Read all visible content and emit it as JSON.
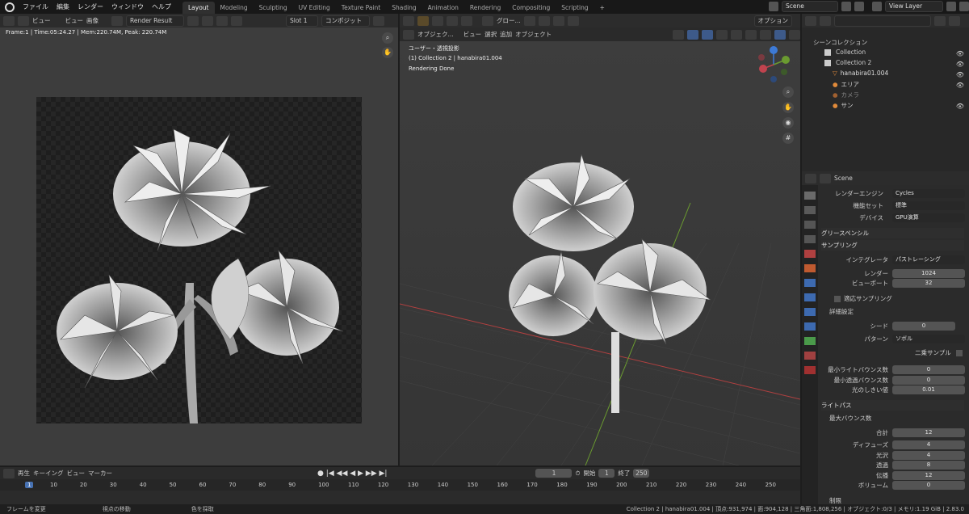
{
  "menu": {
    "file": "ファイル",
    "edit": "編集",
    "render": "レンダー",
    "window": "ウィンドウ",
    "help": "ヘルプ"
  },
  "workspaces": [
    "Layout",
    "Modeling",
    "Sculpting",
    "UV Editing",
    "Texture Paint",
    "Shading",
    "Animation",
    "Rendering",
    "Compositing",
    "Scripting",
    "+"
  ],
  "scene_name": "Scene",
  "view_layer": "View Layer",
  "image_editor": {
    "view_menu": "ビュー",
    "view_btn": "ビュー",
    "image_menu": "画像",
    "image_name": "Render Result",
    "slot": "Slot 1",
    "composite": "コンポジット",
    "info": "Frame:1 | Time:05:24.27 | Mem:220.74M, Peak: 220.74M"
  },
  "viewport": {
    "mode": "オブジェク...",
    "view": "ビュー",
    "select": "選択",
    "add": "追加",
    "object": "オブジェクト",
    "orient": "グロー...",
    "options": "オプション",
    "line1": "ユーザー・透視投影",
    "line2": "(1) Collection 2 | hanabira01.004",
    "line3": "Rendering Done",
    "gizmo_z": "Z",
    "gizmo_y": "Y",
    "gizmo_x": "X"
  },
  "outliner": {
    "title": "シーンコレクション",
    "items": [
      "Collection",
      "Collection 2",
      "hanabira01.004",
      "エリア",
      "カメラ",
      "サン"
    ]
  },
  "props": {
    "scene": "Scene",
    "render_engine_label": "レンダーエンジン",
    "render_engine": "Cycles",
    "feature_set_label": "機能セット",
    "feature_set": "標準",
    "device_label": "デバイス",
    "device": "GPU演算",
    "grease": "グリースペンシル",
    "sampling": "サンプリング",
    "integrator_label": "インテグレータ",
    "integrator": "パストレーシング",
    "render_label": "レンダー",
    "render_val": "1024",
    "viewport_label": "ビューポート",
    "viewport_val": "32",
    "adaptive": "適応サンプリング",
    "advanced": "詳細設定",
    "seed_label": "シード",
    "seed": "0",
    "pattern_label": "パターン",
    "pattern": "ソボル",
    "square": "二乗サンプル",
    "min_light_label": "最小ライトバウンス数",
    "min_light": "0",
    "min_trans_label": "最小透過バウンス数",
    "min_trans": "0",
    "light_thresh_label": "光のしきい値",
    "light_thresh": "0.01",
    "lightpaths": "ライトパス",
    "max_bounce": "最大バウンス数",
    "total_label": "合計",
    "total": "12",
    "diffuse_label": "ディフューズ",
    "diffuse": "4",
    "glossy_label": "光沢",
    "glossy": "4",
    "transp_label": "透過",
    "transp": "8",
    "transm_label": "伝播",
    "transm": "12",
    "volume_label": "ボリューム",
    "volume": "0",
    "clamp": "制限"
  },
  "timeline": {
    "play": "再生",
    "keying": "キーイング",
    "view": "ビュー",
    "marker": "マーカー",
    "frame": "1",
    "start_label": "開始",
    "start": "1",
    "end_label": "終了",
    "end": "250",
    "ticks": [
      "1",
      "10",
      "20",
      "30",
      "40",
      "50",
      "60",
      "70",
      "80",
      "90",
      "100",
      "110",
      "120",
      "130",
      "140",
      "150",
      "160",
      "170",
      "180",
      "190",
      "200",
      "210",
      "220",
      "230",
      "240",
      "250"
    ]
  },
  "status": {
    "left1": "フレームを変更",
    "left2": "視点の移動",
    "left3": "色を採取",
    "right": "Collection 2 | hanabira01.004 | 頂点:931,974 | 面:904,128 | 三角面:1,808,256 | オブジェクト:0/3 | メモリ:1.19 GiB | 2.83.0"
  }
}
